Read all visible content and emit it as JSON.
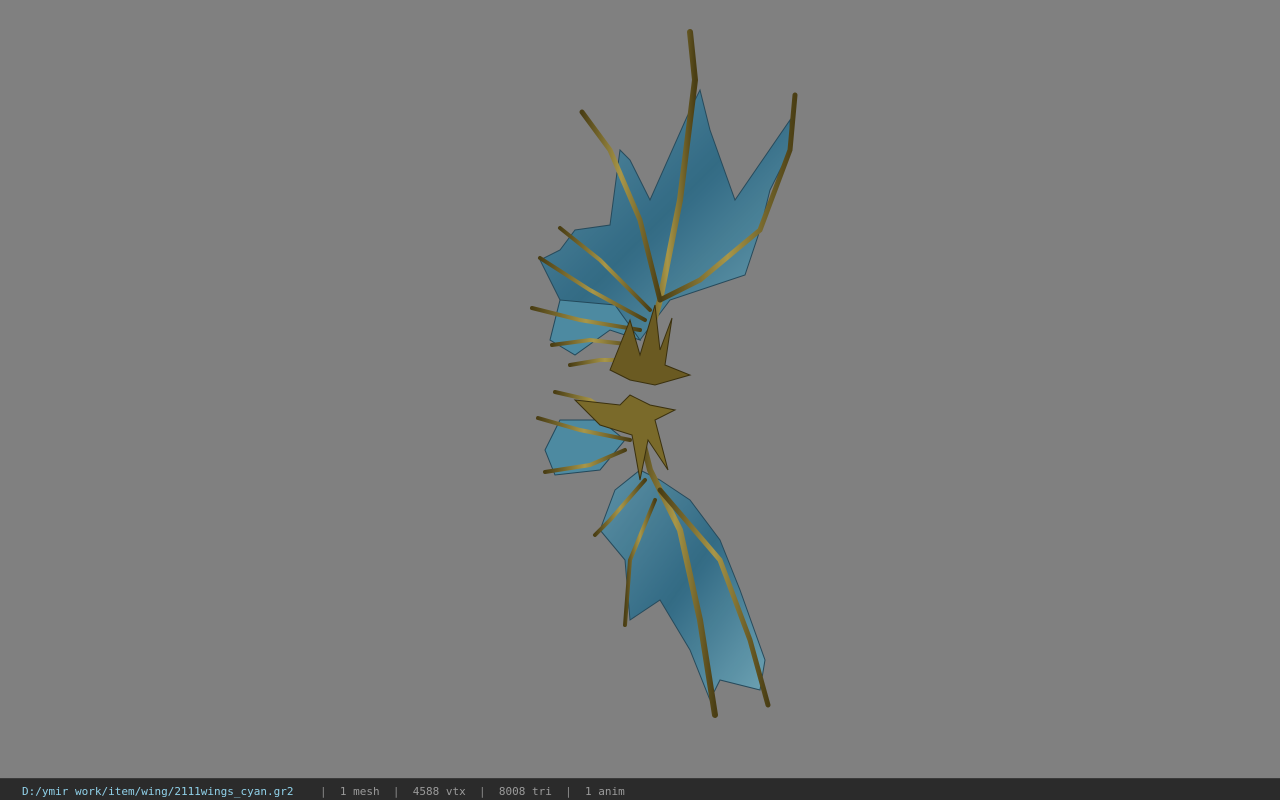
{
  "status": {
    "file_path": "D:/ymir work/item/wing/2111wings_cyan.gr2",
    "separator": "|",
    "mesh_count": "1 mesh",
    "vertex_count": "4588 vtx",
    "triangle_count": "8008 tri",
    "anim_count": "1 anim"
  },
  "colors": {
    "background": "#808080",
    "statusbar": "#2b2b2b",
    "path_text": "#8fd0e8",
    "stat_text": "#9a9a9a",
    "membrane": "#3f7f99",
    "membrane_light": "#7fb4c4",
    "bone": "#6a5a22",
    "bone_light": "#b0a050"
  }
}
